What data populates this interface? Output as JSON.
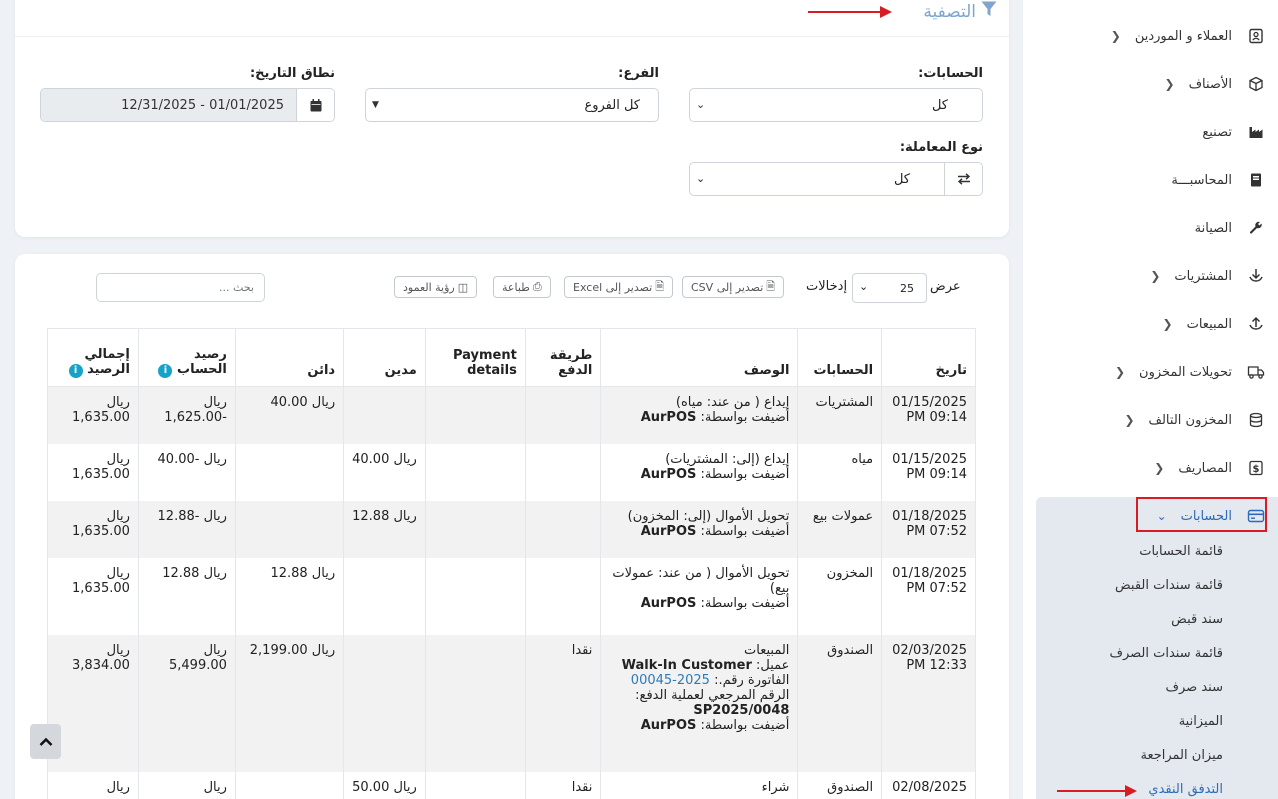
{
  "sidebar": {
    "items": [
      {
        "label": "العملاء و الموردين",
        "icon": "contacts-icon",
        "chevron": true
      },
      {
        "label": "الأصناف",
        "icon": "box-icon",
        "chevron": true
      },
      {
        "label": "تصنيع",
        "icon": "factory-icon",
        "chevron": false
      },
      {
        "label": "المحاسبـــة",
        "icon": "book-icon",
        "chevron": false
      },
      {
        "label": "الصيانة",
        "icon": "wrench-icon",
        "chevron": false
      },
      {
        "label": "المشتريات",
        "icon": "download-icon",
        "chevron": true
      },
      {
        "label": "المبيعات",
        "icon": "upload-icon",
        "chevron": true
      },
      {
        "label": "تحويلات المخزون",
        "icon": "truck-icon",
        "chevron": true
      },
      {
        "label": "المخزون التالف",
        "icon": "database-icon",
        "chevron": true
      },
      {
        "label": "المصاريف",
        "icon": "dollar-icon",
        "chevron": true
      }
    ],
    "accounts": {
      "label": "الحسابات",
      "icon": "credit-card-icon",
      "subitems": [
        "قائمة الحسابات",
        "قائمة سندات القبض",
        "سند قبض",
        "قائمة سندات الصرف",
        "سند صرف",
        "الميزانية",
        "ميزان المراجعة",
        "التدفق النقدي"
      ]
    }
  },
  "filter": {
    "title": "التصفية",
    "accounts_label": "الحسابات:",
    "accounts_value": "كل",
    "branch_label": "الفرع:",
    "branch_value": "كل الفروع",
    "date_label": "نطاق التاريخ:",
    "date_value": "01/01/2025 - 12/31/2025",
    "txn_type_label": "نوع المعاملة:",
    "txn_type_value": "كل"
  },
  "toolbar": {
    "show_label": "عرض",
    "entries_value": "25",
    "entries_label": "إدخالات",
    "export_csv": "تصدير إلى CSV",
    "export_excel": "تصدير إلى Excel",
    "print": "طباعة",
    "column_visibility": "رؤية العمود",
    "search_placeholder": "بحث ..."
  },
  "table": {
    "headers": {
      "date": "تاريخ",
      "account": "الحسابات",
      "description": "الوصف",
      "payment_method": "طريقة الدفع",
      "payment_details": "Payment details",
      "debit": "مدين",
      "credit": "دائن",
      "account_balance": "رصيد الحساب",
      "total_balance": "إجمالي الرصيد"
    },
    "rows": [
      {
        "date": "01/15/2025 09:14 PM",
        "account": "المشتريات",
        "desc1": "إيداع ( من عند: مياه)",
        "desc_by": "أضيفت بواسطة:",
        "by_name": "AurPOS",
        "method": "",
        "details": "",
        "debit": "",
        "credit": "ريال 40.00",
        "acc_bal": "ريال -1,625.00",
        "total": "ريال 1,635.00"
      },
      {
        "date": "01/15/2025 09:14 PM",
        "account": "مياه",
        "desc1": "إيداع (إلى: المشتريات)",
        "desc_by": "أضيفت بواسطة:",
        "by_name": "AurPOS",
        "method": "",
        "details": "",
        "debit": "ريال 40.00",
        "credit": "",
        "acc_bal": "ريال -40.00",
        "total": "ريال 1,635.00"
      },
      {
        "date": "01/18/2025 07:52 PM",
        "account": "عمولات بيع",
        "desc1": "تحويل الأموال (إلى: المخزون)",
        "desc_by": "أضيفت بواسطة:",
        "by_name": "AurPOS",
        "method": "",
        "details": "",
        "debit": "ريال 12.88",
        "credit": "",
        "acc_bal": "ريال -12.88",
        "total": "ريال 1,635.00"
      },
      {
        "date": "01/18/2025 07:52 PM",
        "account": "المخزون",
        "desc1": "تحويل الأموال ( من عند: عمولات بيع)",
        "desc_by": "أضيفت بواسطة:",
        "by_name": "AurPOS",
        "method": "",
        "details": "",
        "debit": "",
        "credit": "ريال 12.88",
        "acc_bal": "ريال 12.88",
        "total": "ريال 1,635.00"
      },
      {
        "date": "02/03/2025 12:33 PM",
        "account": "الصندوق",
        "desc1": "المبيعات",
        "customer_label": "عميل:",
        "customer": "Walk-In Customer",
        "invoice_label": "الفاتورة رقم.:",
        "invoice": "2025-00045",
        "ref_label": "الرقم المرجعي لعملية الدفع:",
        "ref": "SP2025/0048",
        "desc_by": "أضيفت بواسطة:",
        "by_name": "AurPOS",
        "method": "نقدا",
        "details": "",
        "debit": "",
        "credit": "ريال 2,199.00",
        "acc_bal": "ريال 5,499.00",
        "total": "ريال 3,834.00"
      },
      {
        "date": "02/08/2025",
        "account": "الصندوق",
        "desc1": "شراء",
        "method": "نقدا",
        "details": "",
        "debit": "ريال 50.00",
        "credit": "",
        "acc_bal": "ريال",
        "total": "ريال"
      }
    ]
  }
}
